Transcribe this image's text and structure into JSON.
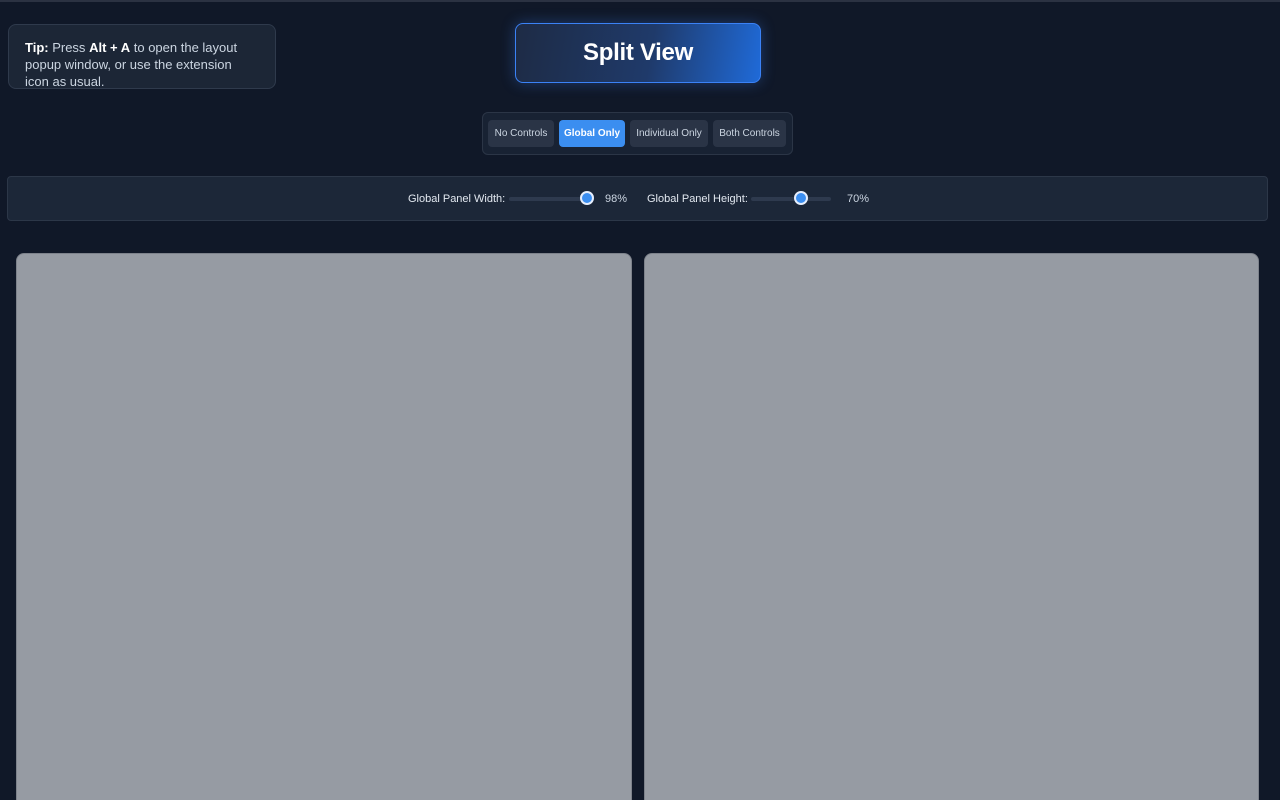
{
  "tip": {
    "lead": "Tip:",
    "text1": " Press ",
    "shortcut": "Alt + A",
    "text2": " to open the layout popup window, or use the extension icon as usual."
  },
  "title": "Split View",
  "modes": [
    {
      "label": "No Controls",
      "active": false
    },
    {
      "label": "Global Only",
      "active": true
    },
    {
      "label": "Individual Only",
      "active": false
    },
    {
      "label": "Both Controls",
      "active": false
    }
  ],
  "controls": {
    "width": {
      "label": "Global Panel Width:",
      "value": 98,
      "value_text": "98%"
    },
    "height": {
      "label": "Global Panel Height:",
      "value": 70,
      "value_text": "70%"
    }
  },
  "colors": {
    "accent": "#3b8ef0",
    "background": "#101828",
    "panel": "#969ba3"
  }
}
